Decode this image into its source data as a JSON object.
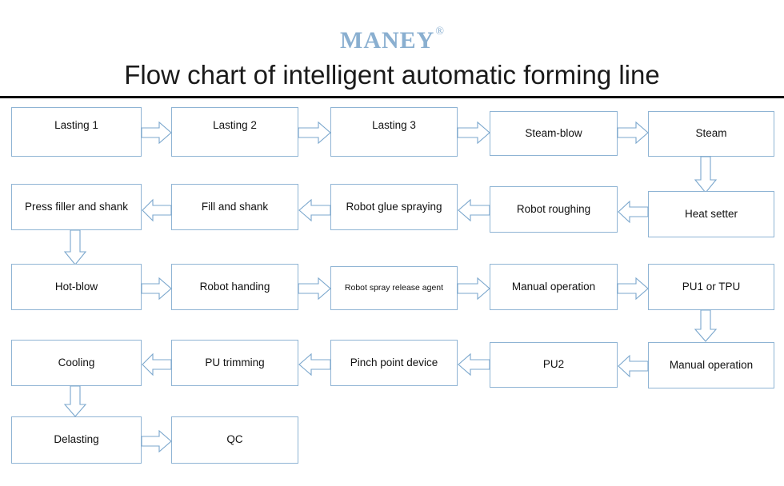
{
  "header": {
    "logo": "MANEY",
    "logo_mark": "®",
    "title": "Flow chart of intelligent automatic forming line"
  },
  "colors": {
    "box_border": "#8fb4d4",
    "arrow_stroke": "#7ba7cd",
    "logo": "#8aafd0",
    "rule": "#000000",
    "text": "#111111",
    "background": "#ffffff"
  },
  "diagram": {
    "type": "flowchart",
    "rows": [
      {
        "direction": "left-to-right",
        "nodes": [
          {
            "id": "lasting-1",
            "label": "Lasting 1"
          },
          {
            "id": "lasting-2",
            "label": "Lasting 2"
          },
          {
            "id": "lasting-3",
            "label": "Lasting 3"
          },
          {
            "id": "steam-blow",
            "label": "Steam-blow"
          },
          {
            "id": "steam",
            "label": "Steam"
          }
        ]
      },
      {
        "direction": "right-to-left",
        "nodes": [
          {
            "id": "press-filler-and-shank",
            "label": "Press filler and shank"
          },
          {
            "id": "fill-and-shank",
            "label": "Fill and shank"
          },
          {
            "id": "robot-glue-spraying",
            "label": "Robot glue spraying"
          },
          {
            "id": "robot-roughing",
            "label": "Robot roughing"
          },
          {
            "id": "heat-setter",
            "label": "Heat setter"
          }
        ]
      },
      {
        "direction": "left-to-right",
        "nodes": [
          {
            "id": "hot-blow",
            "label": "Hot-blow"
          },
          {
            "id": "robot-handing",
            "label": "Robot handing"
          },
          {
            "id": "robot-spray-release-agent",
            "label": "Robot spray release agent"
          },
          {
            "id": "manual-operation-1",
            "label": "Manual operation"
          },
          {
            "id": "pu1-or-tpu",
            "label": "PU1 or TPU"
          }
        ]
      },
      {
        "direction": "right-to-left",
        "nodes": [
          {
            "id": "cooling",
            "label": "Cooling"
          },
          {
            "id": "pu-trimming",
            "label": "PU trimming"
          },
          {
            "id": "pinch-point-device",
            "label": "Pinch point device"
          },
          {
            "id": "pu2",
            "label": "PU2"
          },
          {
            "id": "manual-operation-2",
            "label": "Manual operation"
          }
        ]
      },
      {
        "direction": "left-to-right",
        "nodes": [
          {
            "id": "delasting",
            "label": "Delasting"
          },
          {
            "id": "qc",
            "label": "QC"
          }
        ]
      }
    ],
    "connectors": [
      {
        "from": "lasting-1",
        "to": "lasting-2",
        "orientation": "horizontal",
        "points": "right"
      },
      {
        "from": "lasting-2",
        "to": "lasting-3",
        "orientation": "horizontal",
        "points": "right"
      },
      {
        "from": "lasting-3",
        "to": "steam-blow",
        "orientation": "horizontal",
        "points": "right"
      },
      {
        "from": "steam-blow",
        "to": "steam",
        "orientation": "horizontal",
        "points": "right"
      },
      {
        "from": "steam",
        "to": "heat-setter",
        "orientation": "vertical",
        "points": "down"
      },
      {
        "from": "heat-setter",
        "to": "robot-roughing",
        "orientation": "horizontal",
        "points": "left"
      },
      {
        "from": "robot-roughing",
        "to": "robot-glue-spraying",
        "orientation": "horizontal",
        "points": "left"
      },
      {
        "from": "robot-glue-spraying",
        "to": "fill-and-shank",
        "orientation": "horizontal",
        "points": "left"
      },
      {
        "from": "fill-and-shank",
        "to": "press-filler-and-shank",
        "orientation": "horizontal",
        "points": "left"
      },
      {
        "from": "press-filler-and-shank",
        "to": "hot-blow",
        "orientation": "vertical",
        "points": "down"
      },
      {
        "from": "hot-blow",
        "to": "robot-handing",
        "orientation": "horizontal",
        "points": "right"
      },
      {
        "from": "robot-handing",
        "to": "robot-spray-release-agent",
        "orientation": "horizontal",
        "points": "right"
      },
      {
        "from": "robot-spray-release-agent",
        "to": "manual-operation-1",
        "orientation": "horizontal",
        "points": "right"
      },
      {
        "from": "manual-operation-1",
        "to": "pu1-or-tpu",
        "orientation": "horizontal",
        "points": "right"
      },
      {
        "from": "pu1-or-tpu",
        "to": "manual-operation-2",
        "orientation": "vertical",
        "points": "down"
      },
      {
        "from": "manual-operation-2",
        "to": "pu2",
        "orientation": "horizontal",
        "points": "left"
      },
      {
        "from": "pu2",
        "to": "pinch-point-device",
        "orientation": "horizontal",
        "points": "left"
      },
      {
        "from": "pinch-point-device",
        "to": "pu-trimming",
        "orientation": "horizontal",
        "points": "left"
      },
      {
        "from": "pu-trimming",
        "to": "cooling",
        "orientation": "horizontal",
        "points": "left"
      },
      {
        "from": "cooling",
        "to": "delasting",
        "orientation": "vertical",
        "points": "down"
      },
      {
        "from": "delasting",
        "to": "qc",
        "orientation": "horizontal",
        "points": "right"
      }
    ]
  }
}
